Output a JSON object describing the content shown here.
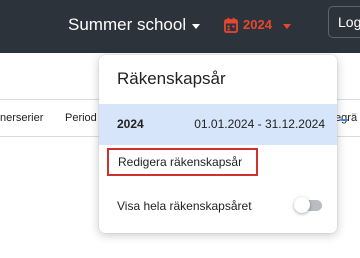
{
  "header": {
    "school_name": "Summer school",
    "fiscal_year": "2024",
    "login_label": "Logga in"
  },
  "nav": {
    "items": [
      "nerserier",
      "Period",
      "tegrä"
    ]
  },
  "fiscal_year_menu": {
    "title": "Räkenskapsår",
    "years": [
      {
        "year": "2024",
        "range": "01.01.2024 - 31.12.2024",
        "selected": true
      }
    ],
    "edit_label": "Redigera räkenskapsår",
    "show_all_label": "Visa hela räkenskapsåret",
    "show_all_enabled": false
  },
  "icons": {
    "calendar": "calendar-icon",
    "caret": "chevron-down-icon",
    "scroll": "scroll-indicator-icon"
  },
  "colors": {
    "topbar": "#2d333b",
    "accent_red": "#e8472f",
    "highlight_outline": "#d0312d",
    "selected_row": "#d7e5fa"
  }
}
